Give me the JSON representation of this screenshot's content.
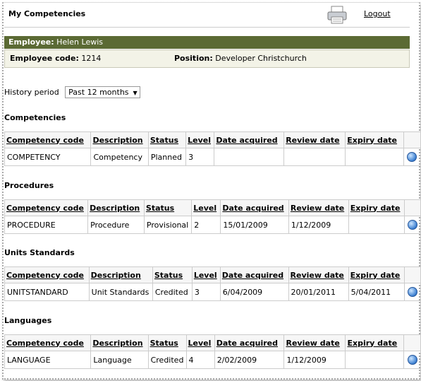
{
  "header": {
    "title": "My Competencies",
    "logout_label": "Logout"
  },
  "employee": {
    "bar_label": "Employee:",
    "bar_name": "Helen Lewis",
    "code_label": "Employee code:",
    "code_value": "1214",
    "position_label": "Position:",
    "position_value": "Developer Christchurch"
  },
  "history": {
    "label": "History period",
    "selected": "Past 12 months"
  },
  "columns": [
    "Competency code",
    "Description",
    "Status",
    "Level",
    "Date acquired",
    "Review date",
    "Expiry date"
  ],
  "sections": [
    {
      "title": "Competencies",
      "row": [
        "COMPETENCY",
        "Competency",
        "Planned",
        "3",
        "",
        "",
        ""
      ]
    },
    {
      "title": "Procedures",
      "row": [
        "PROCEDURE",
        "Procedure",
        "Provisional",
        "2",
        "15/01/2009",
        "1/12/2009",
        ""
      ]
    },
    {
      "title": "Units Standards",
      "row": [
        "UNITSTANDARD",
        "Unit Standards",
        "Credited",
        "3",
        "6/04/2009",
        "20/01/2011",
        "5/04/2011"
      ]
    },
    {
      "title": "Languages",
      "row": [
        "LANGUAGE",
        "Language",
        "Credited",
        "4",
        "2/02/2009",
        "1/12/2009",
        ""
      ]
    }
  ]
}
